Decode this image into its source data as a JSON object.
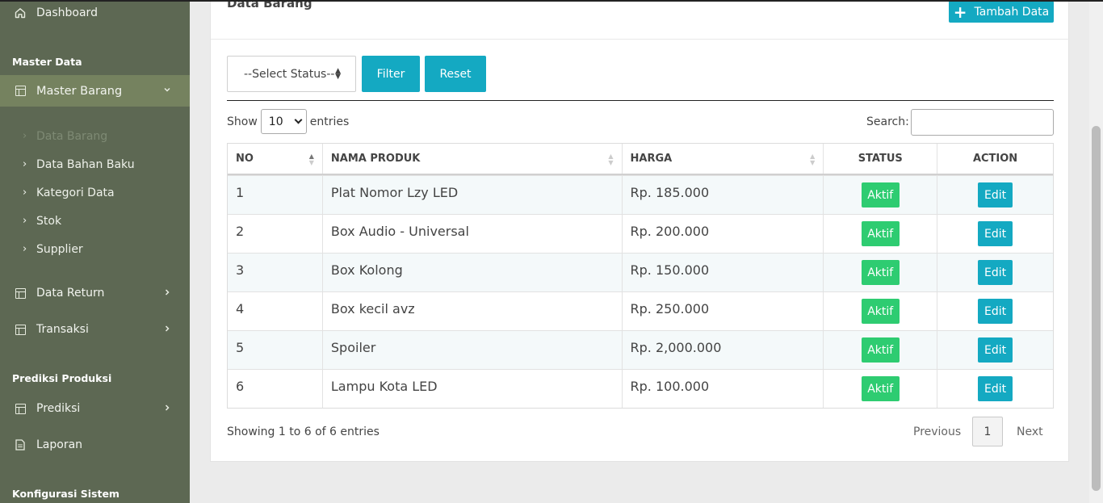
{
  "sidebar": {
    "dashboard": "Dashboard",
    "section_master": "Master Data",
    "master_barang": "Master Barang",
    "sub_items": [
      {
        "label": "Data Barang"
      },
      {
        "label": "Data Bahan Baku"
      },
      {
        "label": "Kategori Data"
      },
      {
        "label": "Stok"
      },
      {
        "label": "Supplier"
      }
    ],
    "data_return": "Data Return",
    "transaksi": "Transaksi",
    "section_prediksi": "Prediksi Produksi",
    "prediksi": "Prediksi",
    "laporan": "Laporan",
    "section_konfig": "Konfigurasi Sistem"
  },
  "card": {
    "title": "Data Barang",
    "add_button": "Tambah Data"
  },
  "filter": {
    "status_select": "--Select Status--",
    "filter_button": "Filter",
    "reset_button": "Reset"
  },
  "table_controls": {
    "show_label": "Show",
    "length_value": "10",
    "entries_label": "entries",
    "search_label": "Search:"
  },
  "table": {
    "headers": [
      "NO",
      "NAMA PRODUK",
      "HARGA",
      "STATUS",
      "ACTION"
    ],
    "rows": [
      {
        "no": "1",
        "name": "Plat Nomor Lzy LED",
        "price": "Rp. 185.000",
        "status": "Aktif",
        "action": "Edit"
      },
      {
        "no": "2",
        "name": "Box Audio - Universal",
        "price": "Rp. 200.000",
        "status": "Aktif",
        "action": "Edit"
      },
      {
        "no": "3",
        "name": "Box Kolong",
        "price": "Rp. 150.000",
        "status": "Aktif",
        "action": "Edit"
      },
      {
        "no": "4",
        "name": "Box kecil avz",
        "price": "Rp. 250.000",
        "status": "Aktif",
        "action": "Edit"
      },
      {
        "no": "5",
        "name": "Spoiler",
        "price": "Rp. 2,000.000",
        "status": "Aktif",
        "action": "Edit"
      },
      {
        "no": "6",
        "name": "Lampu Kota LED",
        "price": "Rp. 100.000",
        "status": "Aktif",
        "action": "Edit"
      }
    ]
  },
  "pagination": {
    "info": "Showing 1 to 6 of 6 entries",
    "previous": "Previous",
    "page": "1",
    "next": "Next"
  },
  "colors": {
    "sidebar_bg": "#5d6853",
    "sidebar_active": "#75825f",
    "accent": "#14a9c2",
    "status_green": "#2ecc71"
  },
  "icons": {
    "dashboard": "home-icon",
    "menu": "table-icon",
    "laporan": "document-icon"
  }
}
